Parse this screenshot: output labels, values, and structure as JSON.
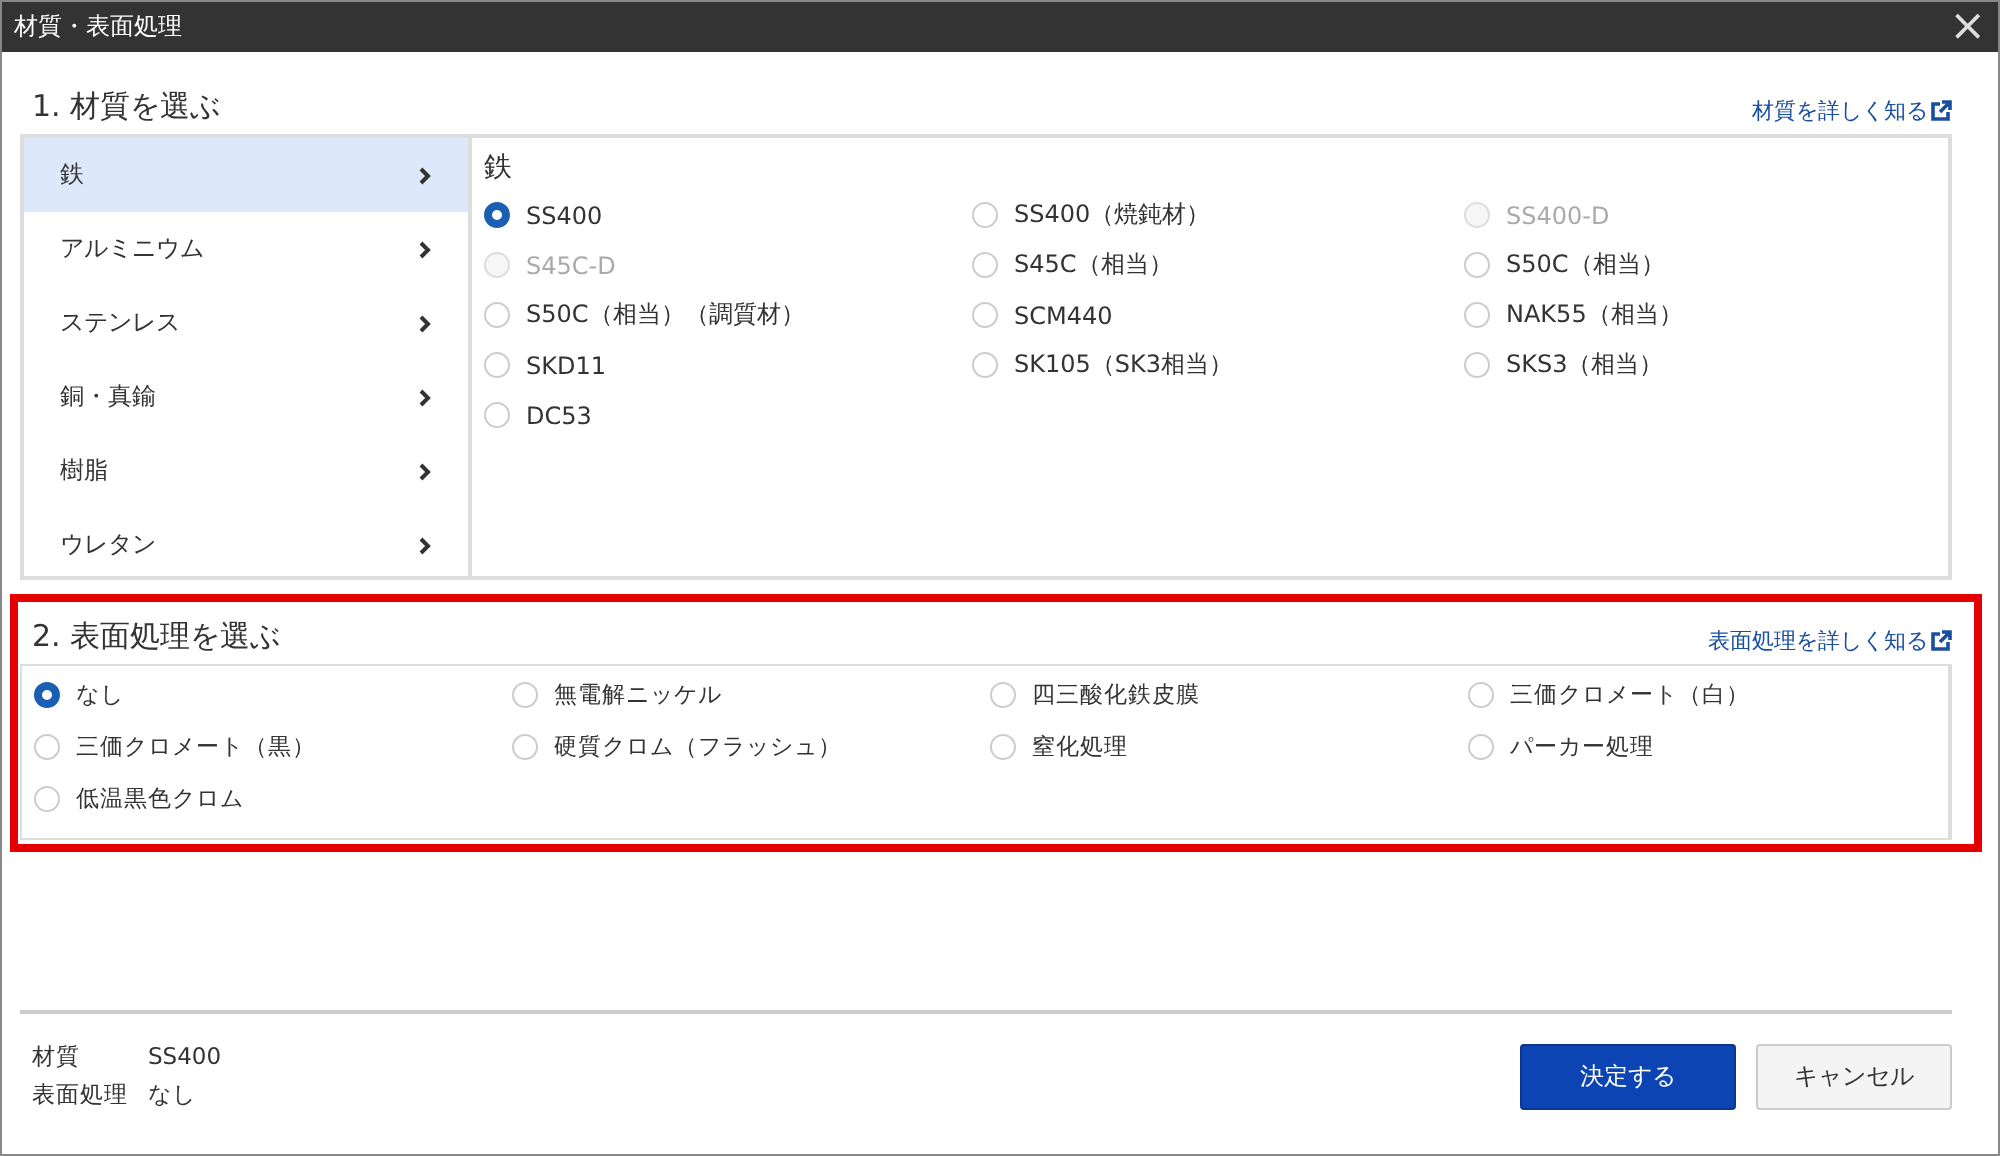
{
  "window": {
    "title": "材質・表面処理",
    "close": "×"
  },
  "material": {
    "heading": "1. 材質を選ぶ",
    "link": "材質を詳しく知る",
    "categories": [
      {
        "label": "鉄",
        "selected": true
      },
      {
        "label": "アルミニウム",
        "selected": false
      },
      {
        "label": "ステンレス",
        "selected": false
      },
      {
        "label": "銅・真鍮",
        "selected": false
      },
      {
        "label": "樹脂",
        "selected": false
      },
      {
        "label": "ウレタン",
        "selected": false
      }
    ],
    "panel_title": "鉄",
    "options": [
      {
        "label": "SS400",
        "selected": true,
        "disabled": false
      },
      {
        "label": "SS400（焼鈍材）",
        "selected": false,
        "disabled": false
      },
      {
        "label": "SS400-D",
        "selected": false,
        "disabled": true
      },
      {
        "label": "S45C-D",
        "selected": false,
        "disabled": true
      },
      {
        "label": "S45C（相当）",
        "selected": false,
        "disabled": false
      },
      {
        "label": "S50C（相当）",
        "selected": false,
        "disabled": false
      },
      {
        "label": "S50C（相当）（調質材）",
        "selected": false,
        "disabled": false
      },
      {
        "label": "SCM440",
        "selected": false,
        "disabled": false
      },
      {
        "label": "NAK55（相当）",
        "selected": false,
        "disabled": false
      },
      {
        "label": "SKD11",
        "selected": false,
        "disabled": false
      },
      {
        "label": "SK105（SK3相当）",
        "selected": false,
        "disabled": false
      },
      {
        "label": "SKS3（相当）",
        "selected": false,
        "disabled": false
      },
      {
        "label": "DC53",
        "selected": false,
        "disabled": false
      }
    ]
  },
  "surface": {
    "heading": "2. 表面処理を選ぶ",
    "link": "表面処理を詳しく知る",
    "highlighted": true,
    "options": [
      {
        "label": "なし",
        "selected": true
      },
      {
        "label": "無電解ニッケル",
        "selected": false
      },
      {
        "label": "四三酸化鉄皮膜",
        "selected": false
      },
      {
        "label": "三価クロメート（白）",
        "selected": false
      },
      {
        "label": "三価クロメート（黒）",
        "selected": false
      },
      {
        "label": "硬質クロム（フラッシュ）",
        "selected": false
      },
      {
        "label": "窒化処理",
        "selected": false
      },
      {
        "label": "パーカー処理",
        "selected": false
      },
      {
        "label": "低温黒色クロム",
        "selected": false
      }
    ]
  },
  "summary": [
    {
      "label": "材質",
      "value": "SS400"
    },
    {
      "label": "表面処理",
      "value": "なし"
    }
  ],
  "buttons": [
    {
      "label": "決定する",
      "kind": "primary"
    },
    {
      "label": "キャンセル",
      "kind": "secondary"
    }
  ]
}
